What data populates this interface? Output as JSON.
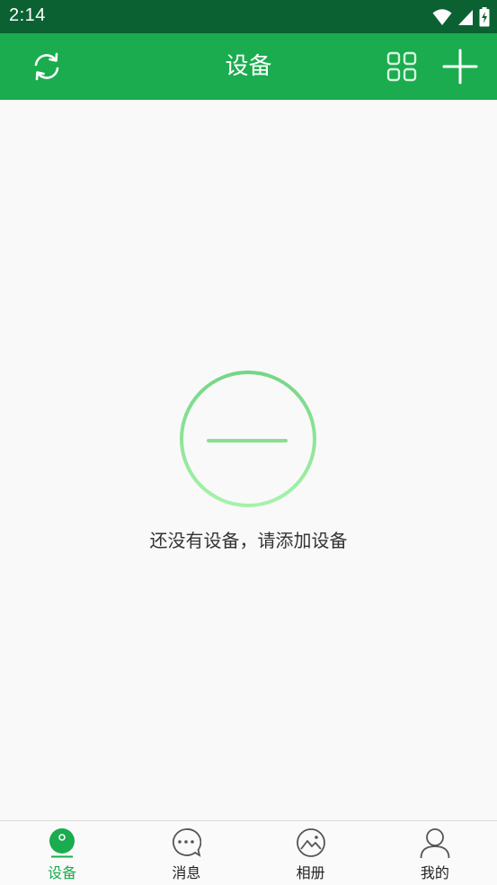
{
  "status_bar": {
    "time": "2:14",
    "icons": [
      "wifi-icon",
      "cell-signal-icon",
      "battery-charging-icon"
    ]
  },
  "app_bar": {
    "title": "设备",
    "left_icon": "refresh-icon",
    "right_icons": [
      "grid-view-icon",
      "add-icon"
    ],
    "background": "#1aac4e"
  },
  "empty_state": {
    "icon": "add-circle-icon",
    "message": "还没有设备，请添加设备"
  },
  "tabs": [
    {
      "label": "设备",
      "icon": "device-icon",
      "active": true
    },
    {
      "label": "消息",
      "icon": "message-icon",
      "active": false
    },
    {
      "label": "相册",
      "icon": "album-icon",
      "active": false
    },
    {
      "label": "我的",
      "icon": "profile-icon",
      "active": false
    }
  ],
  "colors": {
    "accent": "#1aac4e",
    "status_bar": "#0b6132",
    "background": "#f9f9f9"
  }
}
